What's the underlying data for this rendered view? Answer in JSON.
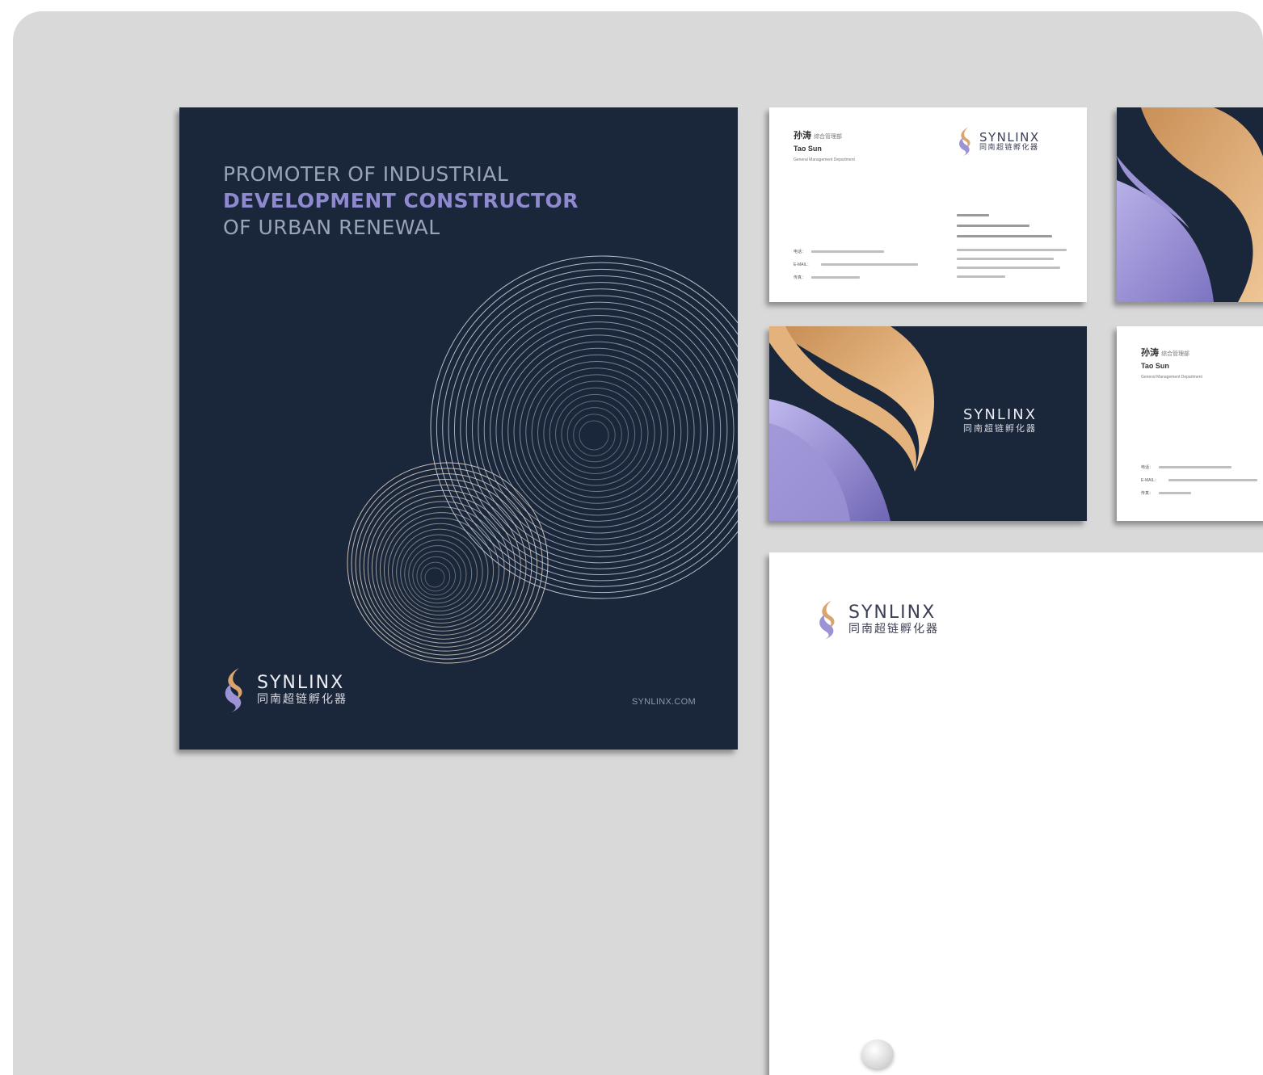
{
  "poster": {
    "headline_line1": "PROMOTER OF INDUSTRIAL",
    "headline_line2": "DEVELOPMENT CONSTRUCTOR",
    "headline_line3": "OF URBAN RENEWAL",
    "url": "SYNLINX.COM",
    "background_color": "#1a2639"
  },
  "brand": {
    "name_en": "SYNLINX",
    "name_cn": "同南超链孵化器",
    "accent_gold": "#d9a46e",
    "accent_lavender": "#9c93d6"
  },
  "business_card": {
    "name_cn": "孙涛",
    "title_cn": "综合管理部",
    "name_en": "Tao Sun",
    "title_en": "General Management Department",
    "phone_label": "电话：",
    "email_label": "E-MAIL：",
    "fax_label": "传真："
  }
}
